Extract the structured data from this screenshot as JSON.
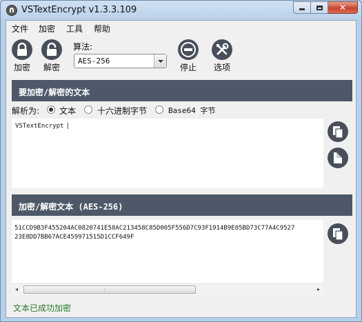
{
  "window": {
    "title": "VSTextEncrypt v1.3.3.109"
  },
  "menu": [
    "文件",
    "加密",
    "工具",
    "帮助"
  ],
  "toolbar": {
    "encrypt_label": "加密",
    "decrypt_label": "解密",
    "algo_label": "算法:",
    "algo_value": "AES-256",
    "stop_label": "停止",
    "options_label": "选项"
  },
  "input_section": {
    "header": "要加密/解密的文本",
    "parse_label": "解析为:",
    "options": [
      "文本",
      "十六进制字节",
      "Base64 字节"
    ],
    "selected_option": "文本",
    "text": "VSTextEncrypt"
  },
  "output_section": {
    "header": "加密/解密文本 (AES-256)",
    "line1": "51CCD9B3F455204AC0820741E58AC213458C85D005F556D7C93F1914B9E05BD73C77A4C9527",
    "line2": "23E8DD7BB67ACE459971515D1CCF649F"
  },
  "status": "文本已成功加密",
  "colors": {
    "header_bg": "#4d5868",
    "status_text": "#2a7a2a",
    "icon_bg": "#484f5a"
  },
  "icons": [
    "lock-icon",
    "unlock-icon",
    "stop-icon",
    "tools-icon",
    "copy-icon",
    "document-icon"
  ]
}
